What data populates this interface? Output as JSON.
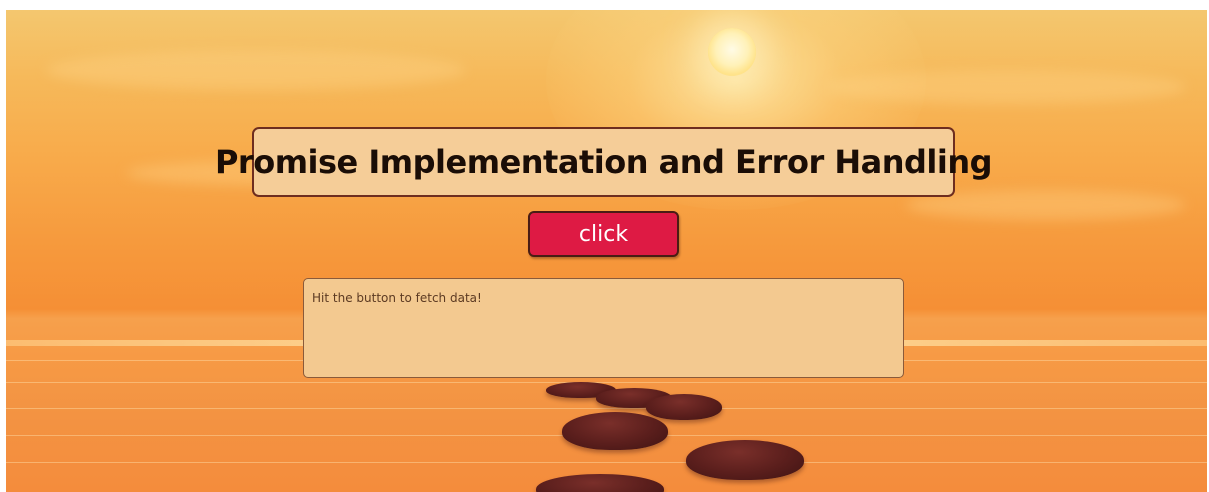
{
  "page": {
    "title": "Promise Implementation and Error Handling"
  },
  "controls": {
    "button_label": "click"
  },
  "output": {
    "text": "Hit the button to fetch data!"
  },
  "colors": {
    "title_bg": "#f5cd98",
    "title_border": "#6e2d1f",
    "button_bg": "#de1a44",
    "output_bg": "#f3c990"
  }
}
